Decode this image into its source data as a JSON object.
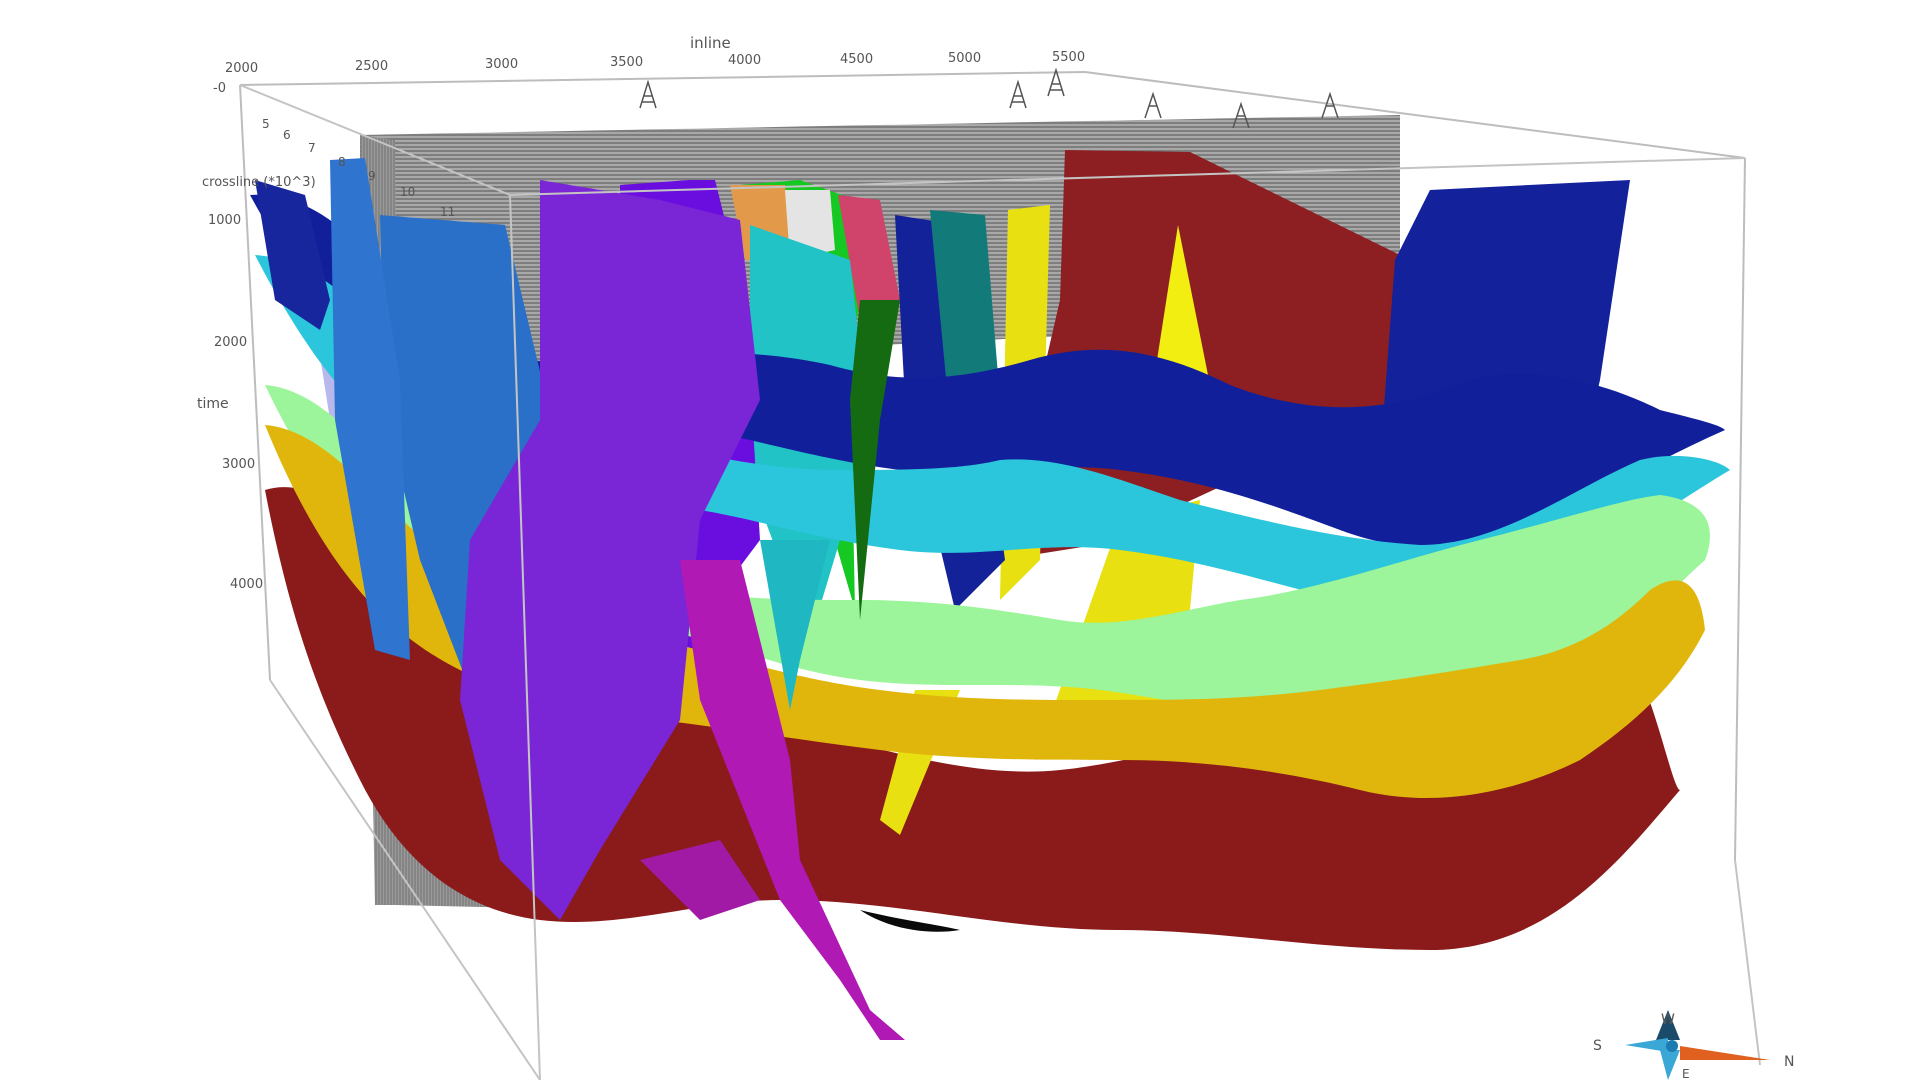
{
  "axes": {
    "inline_title": "inline",
    "inline_ticks": [
      "2000",
      "2500",
      "3000",
      "3500",
      "4000",
      "4500",
      "5000",
      "5500"
    ],
    "crossline_title": "crossline (*10^3)",
    "crossline_ticks": [
      "5",
      "6",
      "7",
      "8",
      "9",
      "10",
      "11"
    ],
    "time_title": "time",
    "time_ticks": [
      "-0",
      "1000",
      "2000",
      "3000",
      "4000"
    ]
  },
  "compass": {
    "w": "W",
    "s": "S",
    "n": "N",
    "e": "E"
  },
  "colors": {
    "horizon_red": "#8b1a1a",
    "horizon_yellow": "#e0b60c",
    "horizon_lightgreen": "#9cf59a",
    "horizon_cyan": "#2cc6dc",
    "horizon_navy": "#10209a",
    "fault_purple": "#7a26d6",
    "fault_blue": "#2a70c8",
    "fault_teal": "#20b8b8",
    "fault_darkred": "#8d1f22",
    "fault_yellow": "#e8e010",
    "seismic_gray": "#909090"
  }
}
